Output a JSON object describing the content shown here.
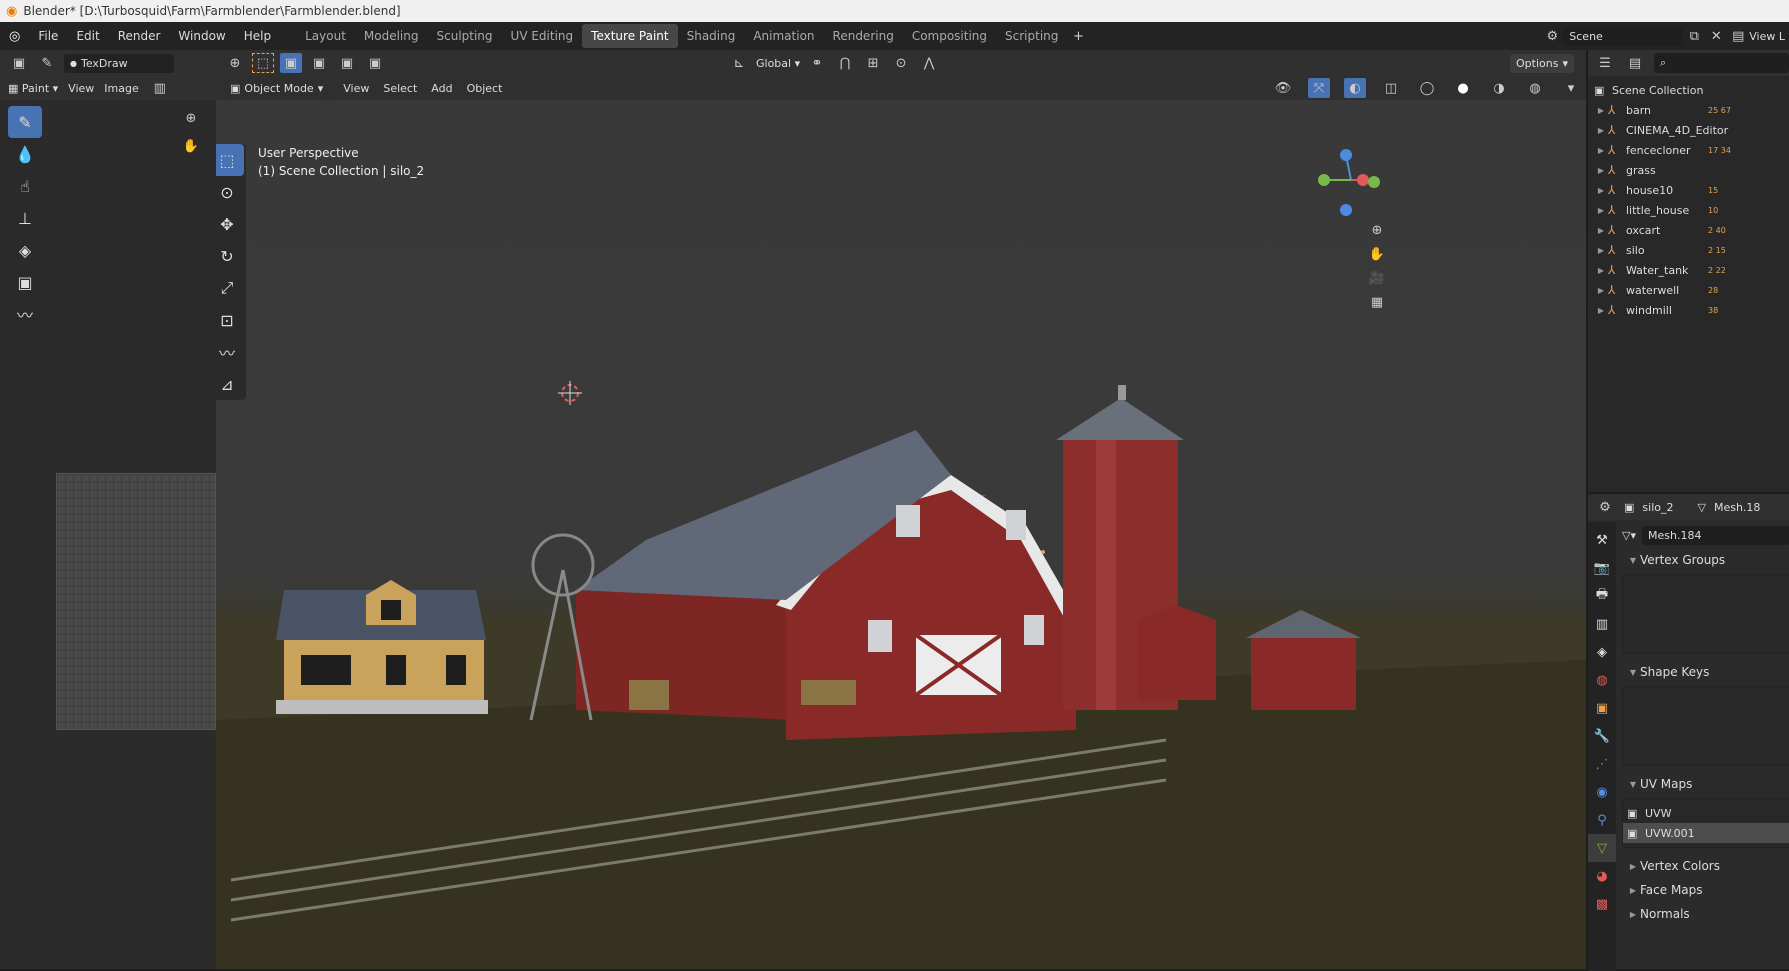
{
  "window": {
    "title": "Blender* [D:\\Turbosquid\\Farm\\Farmblender\\Farmblender.blend]"
  },
  "menus": [
    "File",
    "Edit",
    "Render",
    "Window",
    "Help"
  ],
  "workspaces": [
    {
      "label": "Layout",
      "active": false
    },
    {
      "label": "Modeling",
      "active": false
    },
    {
      "label": "Sculpting",
      "active": false
    },
    {
      "label": "UV Editing",
      "active": false
    },
    {
      "label": "Texture Paint",
      "active": true
    },
    {
      "label": "Shading",
      "active": false
    },
    {
      "label": "Animation",
      "active": false
    },
    {
      "label": "Rendering",
      "active": false
    },
    {
      "label": "Compositing",
      "active": false
    },
    {
      "label": "Scripting",
      "active": false
    }
  ],
  "scene": {
    "name": "Scene",
    "view_layer": "View L"
  },
  "image_editor": {
    "brush": "TexDraw",
    "mode": "Paint",
    "menus": [
      "View",
      "Image"
    ]
  },
  "viewport": {
    "mode": "Object Mode",
    "menus": [
      "View",
      "Select",
      "Add",
      "Object"
    ],
    "orientation": "Global",
    "options": "Options",
    "perspective": "User Perspective",
    "collection_info": "(1) Scene Collection | silo_2"
  },
  "outliner": {
    "root": "Scene Collection",
    "items": [
      {
        "name": "barn",
        "nums": "25 67"
      },
      {
        "name": "CINEMA_4D_Editor",
        "nums": ""
      },
      {
        "name": "fencecloner",
        "nums": "17 34"
      },
      {
        "name": "grass",
        "nums": ""
      },
      {
        "name": "house10",
        "nums": "15"
      },
      {
        "name": "little_house",
        "nums": "10"
      },
      {
        "name": "oxcart",
        "nums": "2 40"
      },
      {
        "name": "silo",
        "nums": "2 15"
      },
      {
        "name": "Water_tank",
        "nums": "2 22"
      },
      {
        "name": "waterwell",
        "nums": "28"
      },
      {
        "name": "windmill",
        "nums": "38"
      }
    ]
  },
  "properties": {
    "object": "silo_2",
    "mesh_header": "Mesh.18",
    "mesh_name": "Mesh.184",
    "sections": {
      "vertex_groups": "Vertex Groups",
      "shape_keys": "Shape Keys",
      "uv_maps": "UV Maps",
      "vertex_colors": "Vertex Colors",
      "face_maps": "Face Maps",
      "normals": "Normals"
    },
    "uv_maps": [
      "UVW",
      "UVW.001"
    ]
  },
  "colors": {
    "accent": "#4772b3",
    "object_orange": "#e8a14f",
    "barn_red": "#8a2a28",
    "roof": "#5f6670",
    "ground": "#3f3d2a"
  }
}
